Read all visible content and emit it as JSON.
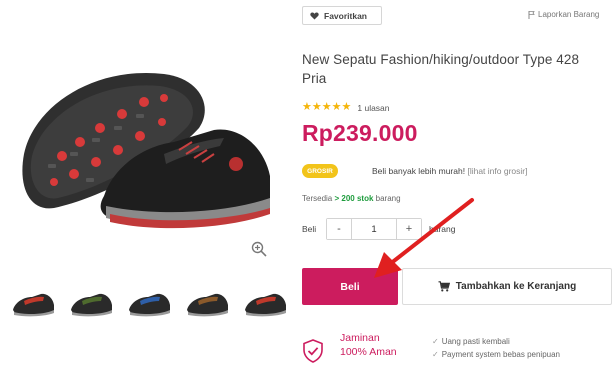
{
  "gallery": {
    "main_image": "shoe-main-image",
    "thumbnails": [
      {
        "name": "thumb-shoe-red",
        "color": "#c0392b"
      },
      {
        "name": "thumb-shoe-green",
        "color": "#4f6b2e"
      },
      {
        "name": "thumb-shoe-blue",
        "color": "#2e5fa8"
      },
      {
        "name": "thumb-shoe-brown",
        "color": "#8b5a2b"
      },
      {
        "name": "thumb-shoe-red-2",
        "color": "#c0392b"
      }
    ]
  },
  "header": {
    "favorite_label": "Favoritkan",
    "report_label": "Laporkan Barang"
  },
  "product": {
    "title": "New Sepatu Fashion/hiking/outdoor Type 428 Pria",
    "stars": 5,
    "review_count": "1 ulasan",
    "price": "Rp239.000",
    "wholesale_badge": "GROSIR",
    "wholesale_text": "Beli banyak lebih murah!",
    "wholesale_link": "[lihat info grosir]",
    "stock_prefix": "Tersedia",
    "stock_value": "> 200 stok",
    "stock_suffix": "barang"
  },
  "purchase": {
    "qty_label": "Beli",
    "minus": "-",
    "quantity": "1",
    "plus": "+",
    "unit": "barang",
    "buy_label": "Beli",
    "cart_label": "Tambahkan ke Keranjang"
  },
  "guarantee": {
    "title_line1": "Jaminan",
    "title_line2": "100% Aman",
    "features": [
      "Uang pasti kembali",
      "Payment system bebas penipuan"
    ]
  },
  "colors": {
    "brand": "#cc1c5e",
    "star": "#f5b50a",
    "badge": "#f2c41a",
    "stock_green": "#1e9c3d",
    "arrow": "#e02020"
  }
}
